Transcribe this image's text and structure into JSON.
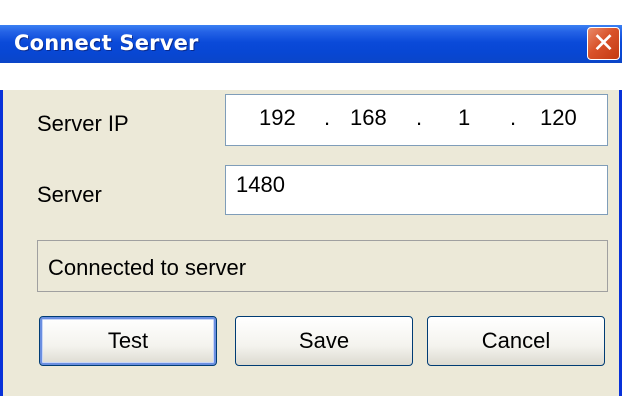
{
  "window": {
    "title": "Connect Server",
    "close_symbol": "✕"
  },
  "form": {
    "server_ip_label": "Server IP",
    "server_ip": {
      "octet1": "192",
      "octet2": "168",
      "octet3": "1",
      "octet4": "120",
      "separator": "."
    },
    "server_label": "Server",
    "server_value": "1480",
    "status_text": "Connected to server"
  },
  "buttons": {
    "test_label": "Test",
    "save_label": "Save",
    "cancel_label": "Cancel"
  },
  "colors": {
    "titlebar": "#0a4ad9",
    "window_bg": "#ece9d8",
    "close_button": "#d9522a"
  },
  "icons": {
    "close": "close-icon"
  }
}
